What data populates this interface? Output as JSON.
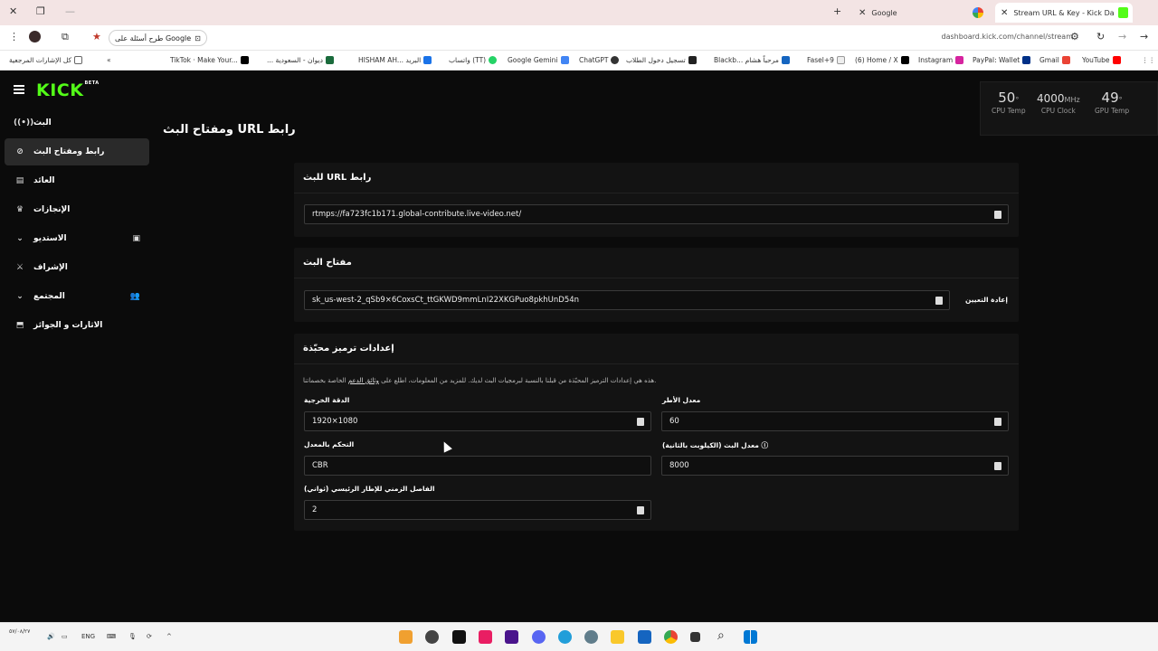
{
  "browser": {
    "tabs": [
      {
        "title": "Google",
        "active": false
      },
      {
        "title": "Stream URL & Key - Kick Dashb",
        "active": true
      }
    ],
    "omnibox_chip": "طرح أسئلة على Google",
    "url": "dashboard.kick.com/channel/stream",
    "bookmarks": [
      "كل الإشارات المرجعية",
      "TikTok · Make Your...",
      "... ديوان - السعودية",
      "HISHAM AH... البريد",
      "واتساب (TT)",
      "Google Gemini",
      "ChatGPT",
      "تسجيل دخول الطلاب",
      "Blackb... مرحباً هشام",
      "Fasel+9",
      "(6) Home / X",
      "Instagram",
      "PayPal: Wallet",
      "Gmail",
      "YouTube"
    ]
  },
  "sidebar": {
    "logo": "KICK",
    "logo_badge": "BETA",
    "items": [
      {
        "label": "البث",
        "icon": "broadcast-icon"
      },
      {
        "label": "رابط ومفتاح البث",
        "icon": "link-icon",
        "active": true
      },
      {
        "label": "العائد",
        "icon": "chart-icon"
      },
      {
        "label": "الإنجازات",
        "icon": "trophy-icon"
      },
      {
        "label": "الاستديو",
        "icon": "studio-icon"
      },
      {
        "label": "الإشراف",
        "icon": "sword-icon"
      },
      {
        "label": "المجتمع",
        "icon": "community-icon"
      },
      {
        "label": "الاثارات و الجوائز",
        "icon": "rewards-icon"
      }
    ]
  },
  "page": {
    "title": "ومفتاح البث URL رابط"
  },
  "stream_url_card": {
    "title": "للبث URL رابط",
    "value": "rtmps://fa723fc1b171.global-contribute.live-video.net/"
  },
  "stream_key_card": {
    "title": "مفتاح البث",
    "value": "sk_us-west-2_qSb9×6CoxsCt_ttGKWD9mmLnI22XKGPuo8pkhUnD54n",
    "reset_label": "إعادة التعيين"
  },
  "encoder_card": {
    "title": "إعدادات ترميز محبّذة",
    "description_pre": "هذه هي إعدادات الترميز المحبّذة من قبلنا بالنسبة لبرمجيات البث لديك. للمزيد من المعلومات، اطلع على",
    "description_link": "وثائق الدعم",
    "description_post": "الخاصة بخصماتنا.",
    "resolution": {
      "label": "الدقة الخرجية",
      "value": "1920×1080"
    },
    "framerate": {
      "label": "معدل الأطر",
      "value": "60"
    },
    "rate_control": {
      "label": "التحكم بالمعدل",
      "value": "CBR"
    },
    "bitrate": {
      "label": "معدل البث (الكيلوبت بالثانية)",
      "value": "8000"
    },
    "keyframe": {
      "label": "الفاصل الزمني للإطار الرئيسي (ثواني)",
      "value": "2"
    }
  },
  "sensors": [
    {
      "value": "50",
      "unit": "°",
      "label": "CPU Temp"
    },
    {
      "value": "4000",
      "unit": "MHz",
      "label": "CPU Clock"
    },
    {
      "value": "49",
      "unit": "°",
      "label": "GPU Temp"
    }
  ],
  "taskbar": {
    "tray_lang": "ENG",
    "clock": "٥٧/٠٨/٢٧"
  },
  "colors": {
    "kick_green": "#53fc18",
    "background": "#0b0b0b",
    "card": "#131313"
  }
}
